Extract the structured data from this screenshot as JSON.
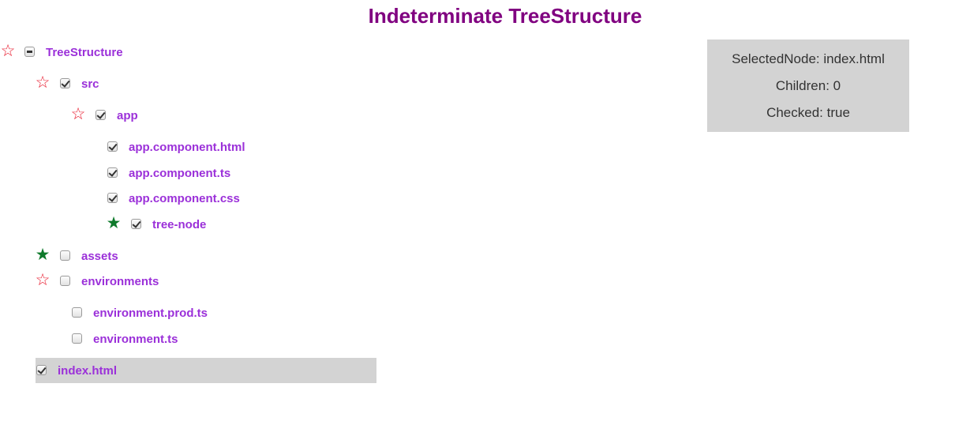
{
  "title": "Indeterminate TreeStructure",
  "tree": {
    "root": {
      "label": "TreeStructure",
      "star": "outline",
      "state": "indeterminate"
    },
    "src": {
      "label": "src",
      "star": "outline",
      "state": "checked"
    },
    "app": {
      "label": "app",
      "star": "outline",
      "state": "checked"
    },
    "app_component_html": {
      "label": "app.component.html",
      "state": "checked"
    },
    "app_component_ts": {
      "label": "app.component.ts",
      "state": "checked"
    },
    "app_component_css": {
      "label": "app.component.css",
      "state": "checked"
    },
    "tree_node": {
      "label": "tree-node",
      "star": "filled",
      "state": "checked"
    },
    "assets": {
      "label": "assets",
      "star": "filled",
      "state": "unchecked"
    },
    "environments": {
      "label": "environments",
      "star": "outline",
      "state": "unchecked"
    },
    "environment_prod_ts": {
      "label": "environment.prod.ts",
      "state": "unchecked"
    },
    "environment_ts": {
      "label": "environment.ts",
      "state": "unchecked"
    },
    "index_html": {
      "label": "index.html",
      "state": "checked",
      "selected": true
    }
  },
  "info": {
    "selected_node": "SelectedNode: index.html",
    "children": "Children: 0",
    "checked": "Checked: true"
  },
  "colors": {
    "title": "#800080",
    "label": "#9b30d9",
    "star_outline": "#e8192c",
    "star_filled": "#0e7a2b",
    "selected_bg": "#d3d3d3",
    "info_bg": "#d3d3d3"
  }
}
